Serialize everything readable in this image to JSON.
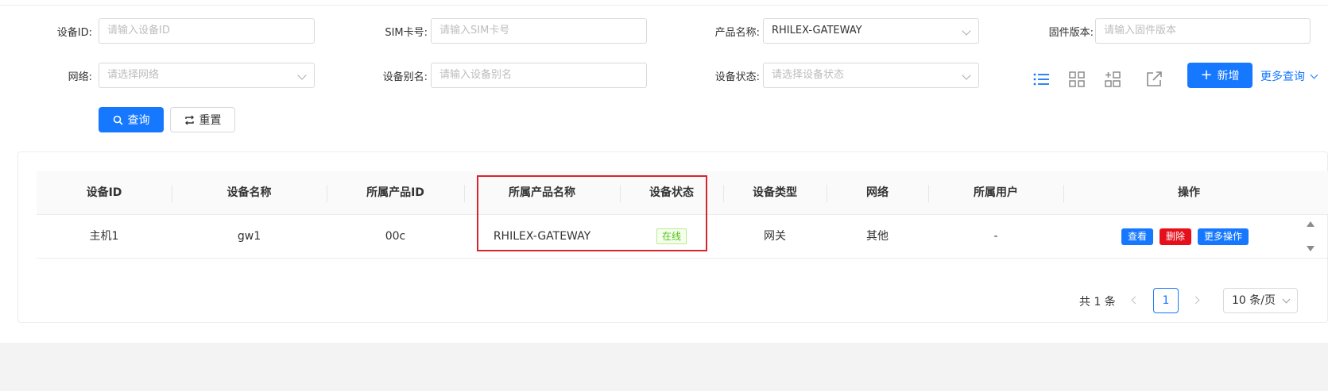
{
  "filters": {
    "device_id": {
      "label": "设备ID:",
      "placeholder": "请输入设备ID"
    },
    "sim": {
      "label": "SIM卡号:",
      "placeholder": "请输入SIM卡号"
    },
    "product_name": {
      "label": "产品名称:",
      "value": "RHILEX-GATEWAY"
    },
    "firmware": {
      "label": "固件版本:",
      "placeholder": "请输入固件版本"
    },
    "network": {
      "label": "网络:",
      "placeholder": "请选择网络"
    },
    "alias": {
      "label": "设备别名:",
      "placeholder": "请输入设备别名"
    },
    "status": {
      "label": "设备状态:",
      "placeholder": "请选择设备状态"
    }
  },
  "actions": {
    "query": "查询",
    "reset": "重置",
    "add": "新增",
    "more_query": "更多查询"
  },
  "toolbar_icons": [
    "list-view-icon",
    "grid-view-icon",
    "card-add-icon",
    "export-icon"
  ],
  "table": {
    "headers": [
      "设备ID",
      "设备名称",
      "所属产品ID",
      "所属产品名称",
      "设备状态",
      "设备类型",
      "网络",
      "所属用户",
      "操作"
    ],
    "rows": [
      {
        "device_id": "主机1",
        "device_name": "gw1",
        "product_id": "00c",
        "product_name": "RHILEX-GATEWAY",
        "status": "在线",
        "device_type": "网关",
        "network": "其他",
        "user": "-",
        "ops": {
          "view": "查看",
          "delete": "删除",
          "more": "更多操作"
        }
      }
    ]
  },
  "pagination": {
    "total": "共 1 条",
    "current_page": "1",
    "page_size": "10 条/页"
  },
  "colors": {
    "primary": "#1677ff",
    "danger": "#e5101b",
    "online": "#52c41a",
    "highlight": "#d6262d"
  }
}
